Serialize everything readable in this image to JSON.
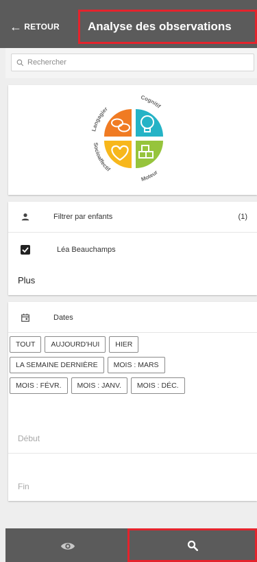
{
  "header": {
    "back_label": "RETOUR",
    "title": "Analyse des observations"
  },
  "search": {
    "placeholder": "Rechercher"
  },
  "logo": {
    "labels": [
      "Langagier",
      "Cognitif",
      "Socioaffectif",
      "Moteur"
    ]
  },
  "filter": {
    "label": "Filtrer par enfants",
    "count": "(1)",
    "child_name": "Léa Beauchamps",
    "more_label": "Plus"
  },
  "dates": {
    "label": "Dates",
    "chip_rows": [
      [
        "TOUT",
        "AUJOURD'HUI",
        "HIER"
      ],
      [
        "LA SEMAINE DERNIÈRE",
        "MOIS : MARS"
      ],
      [
        "MOIS : FÉVR.",
        "MOIS : JANV.",
        "MOIS : DÉC."
      ]
    ],
    "start_label": "Début",
    "end_label": "Fin"
  },
  "colors": {
    "header_bg": "#5b5b5b",
    "highlight": "#e5232c",
    "orange": "#f07b23",
    "teal": "#25b3c6",
    "yellow": "#f7b71c",
    "green": "#96c43c"
  },
  "icons": {
    "back": "arrow-left-icon",
    "search": "search-icon",
    "person": "person-icon",
    "checkbox": "checkbox-checked-icon",
    "calendar": "calendar-icon",
    "eye": "eye-icon"
  }
}
